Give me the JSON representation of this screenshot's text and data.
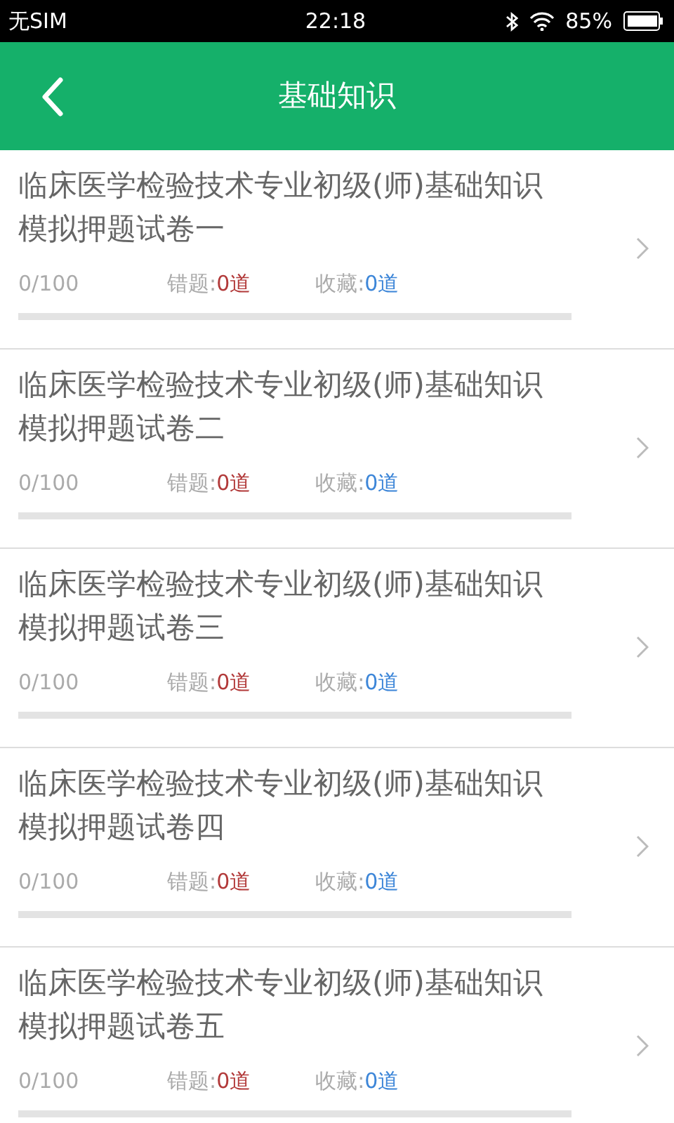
{
  "status_bar": {
    "carrier": "无SIM",
    "time": "22:18",
    "battery": "85%"
  },
  "header": {
    "title": "基础知识"
  },
  "papers": [
    {
      "title": "临床医学检验技术专业初级(师)基础知识模拟押题试卷一",
      "progress": "0/100",
      "wrong_label": "错题:",
      "wrong": "0道",
      "fav_label": "收藏:",
      "fav": "0道",
      "level": 0
    },
    {
      "title": "临床医学检验技术专业初级(师)基础知识模拟押题试卷二",
      "progress": "0/100",
      "wrong_label": "错题:",
      "wrong": "0道",
      "fav_label": "收藏:",
      "fav": "0道",
      "level": 0
    },
    {
      "title": "临床医学检验技术专业初级(师)基础知识模拟押题试卷三",
      "progress": "0/100",
      "wrong_label": "错题:",
      "wrong": "0道",
      "fav_label": "收藏:",
      "fav": "0道",
      "level": 0
    },
    {
      "title": "临床医学检验技术专业初级(师)基础知识模拟押题试卷四",
      "progress": "0/100",
      "wrong_label": "错题:",
      "wrong": "0道",
      "fav_label": "收藏:",
      "fav": "0道",
      "level": 0
    },
    {
      "title": "临床医学检验技术专业初级(师)基础知识模拟押题试卷五",
      "progress": "0/100",
      "wrong_label": "错题:",
      "wrong": "0道",
      "fav_label": "收藏:",
      "fav": "0道",
      "level": 0
    }
  ]
}
